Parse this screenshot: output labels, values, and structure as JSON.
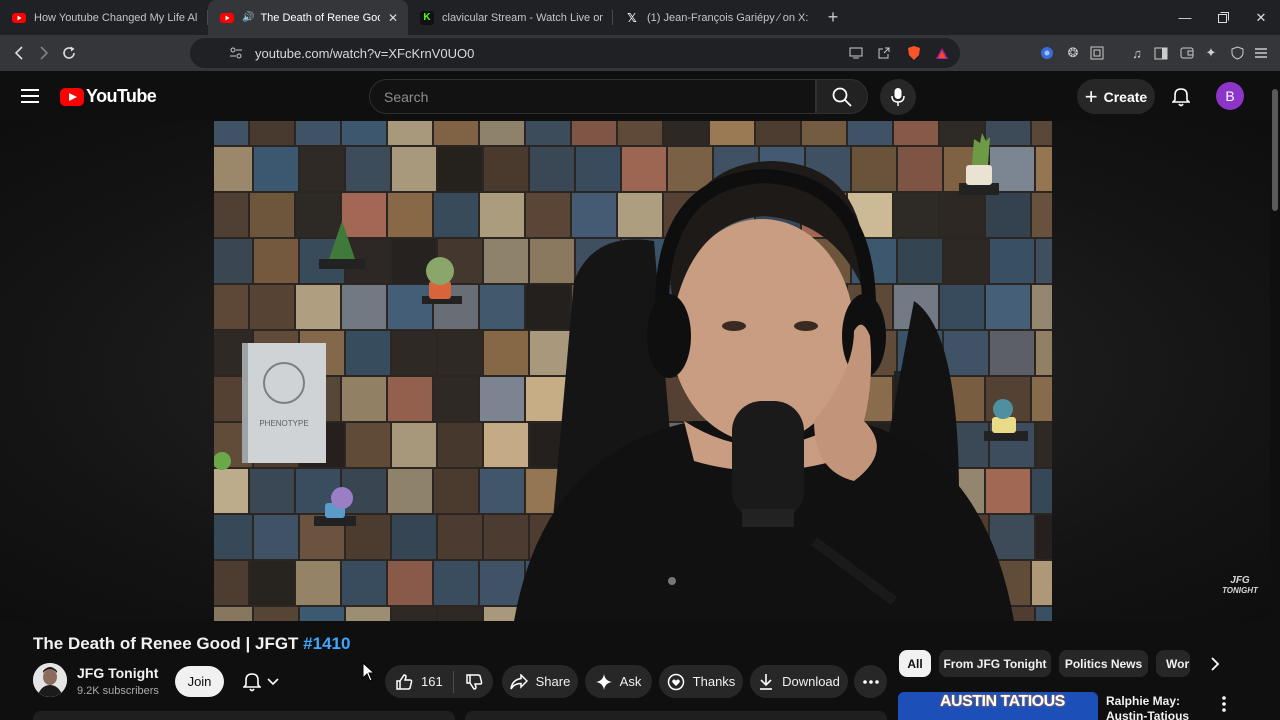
{
  "browser": {
    "tabs": [
      {
        "title": "How Youtube Changed My Life Alrea",
        "favicon": "youtube-icon",
        "active": false
      },
      {
        "title": "The Death of Renee Good | JF",
        "favicon": "youtube-icon",
        "active": true
      },
      {
        "title": "clavicular Stream - Watch Live on Kic",
        "favicon": "kick-icon",
        "active": false
      },
      {
        "title": "(1) Jean-François Gariépy ⁄ on X: \"",
        "favicon": "x-icon",
        "active": false
      }
    ],
    "url": "youtube.com/watch?v=XFcKrnV0UO0"
  },
  "youtube": {
    "logo_text": "YouTube",
    "search_placeholder": "Search",
    "create_label": "Create",
    "avatar_letter": "B"
  },
  "video": {
    "watermark_line1": "JFG",
    "watermark_line2": "TONIGHT",
    "book_title": "PHENOTYPE",
    "title_main": "The Death of Renee Good | JFGT ",
    "title_tag": "#1410"
  },
  "channel": {
    "name": "JFG Tonight",
    "subscribers": "9.2K subscribers",
    "join_label": "Join"
  },
  "actions": {
    "like_count": "161",
    "share_label": "Share",
    "ask_label": "Ask",
    "thanks_label": "Thanks",
    "download_label": "Download"
  },
  "chips": [
    "All",
    "From JFG Tonight",
    "Politics News",
    "Wor"
  ],
  "recommendation": {
    "thumb_text": "AUSTIN TATIOUS",
    "title": "Ralphie May: Austin-Tatious"
  },
  "colors": {
    "youtube_red": "#ff0000",
    "accent_blue": "#3ea6ff",
    "avatar_purple": "#8e35c9"
  }
}
